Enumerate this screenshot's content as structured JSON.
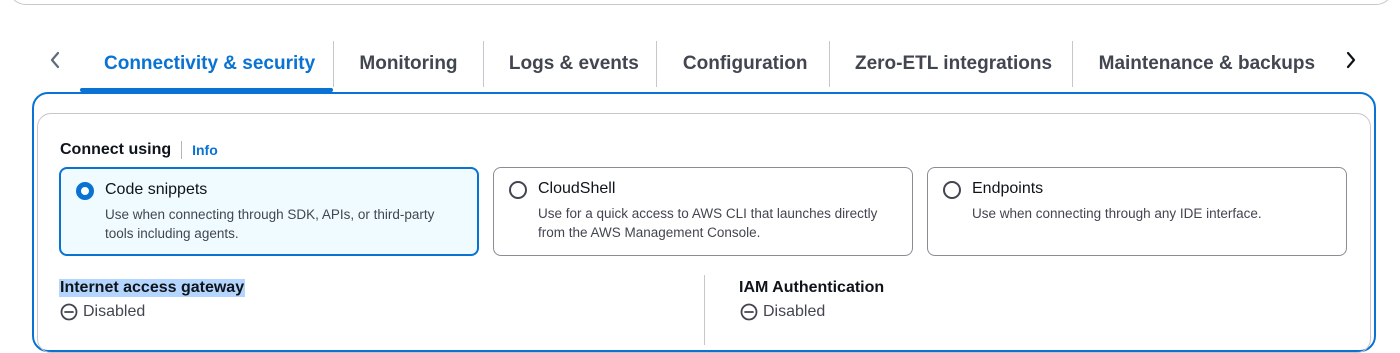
{
  "tabs": [
    {
      "label": "Connectivity & security",
      "active": true
    },
    {
      "label": "Monitoring",
      "active": false
    },
    {
      "label": "Logs & events",
      "active": false
    },
    {
      "label": "Configuration",
      "active": false
    },
    {
      "label": "Zero-ETL integrations",
      "active": false
    },
    {
      "label": "Maintenance & backups",
      "active": false
    }
  ],
  "tab_nav": {
    "prev_icon": "chevron-left-icon",
    "next_icon": "chevron-right-icon"
  },
  "connect": {
    "title": "Connect using",
    "info_label": "Info"
  },
  "options": [
    {
      "title": "Code snippets",
      "description": "Use when connecting through SDK, APIs, or third-party tools including agents.",
      "selected": true
    },
    {
      "title": "CloudShell",
      "description": "Use for a quick access to AWS CLI that launches directly from the AWS Management Console.",
      "selected": false
    },
    {
      "title": "Endpoints",
      "description": "Use when connecting through any IDE interface.",
      "selected": false
    }
  ],
  "details": {
    "internet_access_gateway": {
      "label": "Internet access gateway",
      "value": "Disabled",
      "icon": "minus-circle-icon"
    },
    "iam_authentication": {
      "label": "IAM Authentication",
      "value": "Disabled",
      "icon": "minus-circle-icon"
    }
  },
  "colors": {
    "accent": "#0972d3",
    "selected_bg": "#f0fbff",
    "border": "#c6c6cd",
    "highlight": "#b4d5fe"
  }
}
